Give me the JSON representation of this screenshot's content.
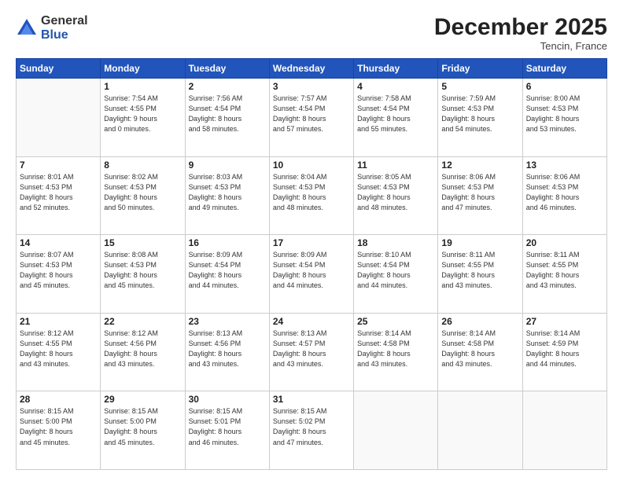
{
  "header": {
    "logo_general": "General",
    "logo_blue": "Blue",
    "month_title": "December 2025",
    "location": "Tencin, France"
  },
  "days_of_week": [
    "Sunday",
    "Monday",
    "Tuesday",
    "Wednesday",
    "Thursday",
    "Friday",
    "Saturday"
  ],
  "weeks": [
    [
      {
        "day": "",
        "info": ""
      },
      {
        "day": "1",
        "info": "Sunrise: 7:54 AM\nSunset: 4:55 PM\nDaylight: 9 hours\nand 0 minutes."
      },
      {
        "day": "2",
        "info": "Sunrise: 7:56 AM\nSunset: 4:54 PM\nDaylight: 8 hours\nand 58 minutes."
      },
      {
        "day": "3",
        "info": "Sunrise: 7:57 AM\nSunset: 4:54 PM\nDaylight: 8 hours\nand 57 minutes."
      },
      {
        "day": "4",
        "info": "Sunrise: 7:58 AM\nSunset: 4:54 PM\nDaylight: 8 hours\nand 55 minutes."
      },
      {
        "day": "5",
        "info": "Sunrise: 7:59 AM\nSunset: 4:53 PM\nDaylight: 8 hours\nand 54 minutes."
      },
      {
        "day": "6",
        "info": "Sunrise: 8:00 AM\nSunset: 4:53 PM\nDaylight: 8 hours\nand 53 minutes."
      }
    ],
    [
      {
        "day": "7",
        "info": "Sunrise: 8:01 AM\nSunset: 4:53 PM\nDaylight: 8 hours\nand 52 minutes."
      },
      {
        "day": "8",
        "info": "Sunrise: 8:02 AM\nSunset: 4:53 PM\nDaylight: 8 hours\nand 50 minutes."
      },
      {
        "day": "9",
        "info": "Sunrise: 8:03 AM\nSunset: 4:53 PM\nDaylight: 8 hours\nand 49 minutes."
      },
      {
        "day": "10",
        "info": "Sunrise: 8:04 AM\nSunset: 4:53 PM\nDaylight: 8 hours\nand 48 minutes."
      },
      {
        "day": "11",
        "info": "Sunrise: 8:05 AM\nSunset: 4:53 PM\nDaylight: 8 hours\nand 48 minutes."
      },
      {
        "day": "12",
        "info": "Sunrise: 8:06 AM\nSunset: 4:53 PM\nDaylight: 8 hours\nand 47 minutes."
      },
      {
        "day": "13",
        "info": "Sunrise: 8:06 AM\nSunset: 4:53 PM\nDaylight: 8 hours\nand 46 minutes."
      }
    ],
    [
      {
        "day": "14",
        "info": "Sunrise: 8:07 AM\nSunset: 4:53 PM\nDaylight: 8 hours\nand 45 minutes."
      },
      {
        "day": "15",
        "info": "Sunrise: 8:08 AM\nSunset: 4:53 PM\nDaylight: 8 hours\nand 45 minutes."
      },
      {
        "day": "16",
        "info": "Sunrise: 8:09 AM\nSunset: 4:54 PM\nDaylight: 8 hours\nand 44 minutes."
      },
      {
        "day": "17",
        "info": "Sunrise: 8:09 AM\nSunset: 4:54 PM\nDaylight: 8 hours\nand 44 minutes."
      },
      {
        "day": "18",
        "info": "Sunrise: 8:10 AM\nSunset: 4:54 PM\nDaylight: 8 hours\nand 44 minutes."
      },
      {
        "day": "19",
        "info": "Sunrise: 8:11 AM\nSunset: 4:55 PM\nDaylight: 8 hours\nand 43 minutes."
      },
      {
        "day": "20",
        "info": "Sunrise: 8:11 AM\nSunset: 4:55 PM\nDaylight: 8 hours\nand 43 minutes."
      }
    ],
    [
      {
        "day": "21",
        "info": "Sunrise: 8:12 AM\nSunset: 4:55 PM\nDaylight: 8 hours\nand 43 minutes."
      },
      {
        "day": "22",
        "info": "Sunrise: 8:12 AM\nSunset: 4:56 PM\nDaylight: 8 hours\nand 43 minutes."
      },
      {
        "day": "23",
        "info": "Sunrise: 8:13 AM\nSunset: 4:56 PM\nDaylight: 8 hours\nand 43 minutes."
      },
      {
        "day": "24",
        "info": "Sunrise: 8:13 AM\nSunset: 4:57 PM\nDaylight: 8 hours\nand 43 minutes."
      },
      {
        "day": "25",
        "info": "Sunrise: 8:14 AM\nSunset: 4:58 PM\nDaylight: 8 hours\nand 43 minutes."
      },
      {
        "day": "26",
        "info": "Sunrise: 8:14 AM\nSunset: 4:58 PM\nDaylight: 8 hours\nand 43 minutes."
      },
      {
        "day": "27",
        "info": "Sunrise: 8:14 AM\nSunset: 4:59 PM\nDaylight: 8 hours\nand 44 minutes."
      }
    ],
    [
      {
        "day": "28",
        "info": "Sunrise: 8:15 AM\nSunset: 5:00 PM\nDaylight: 8 hours\nand 45 minutes."
      },
      {
        "day": "29",
        "info": "Sunrise: 8:15 AM\nSunset: 5:00 PM\nDaylight: 8 hours\nand 45 minutes."
      },
      {
        "day": "30",
        "info": "Sunrise: 8:15 AM\nSunset: 5:01 PM\nDaylight: 8 hours\nand 46 minutes."
      },
      {
        "day": "31",
        "info": "Sunrise: 8:15 AM\nSunset: 5:02 PM\nDaylight: 8 hours\nand 47 minutes."
      },
      {
        "day": "",
        "info": ""
      },
      {
        "day": "",
        "info": ""
      },
      {
        "day": "",
        "info": ""
      }
    ]
  ]
}
